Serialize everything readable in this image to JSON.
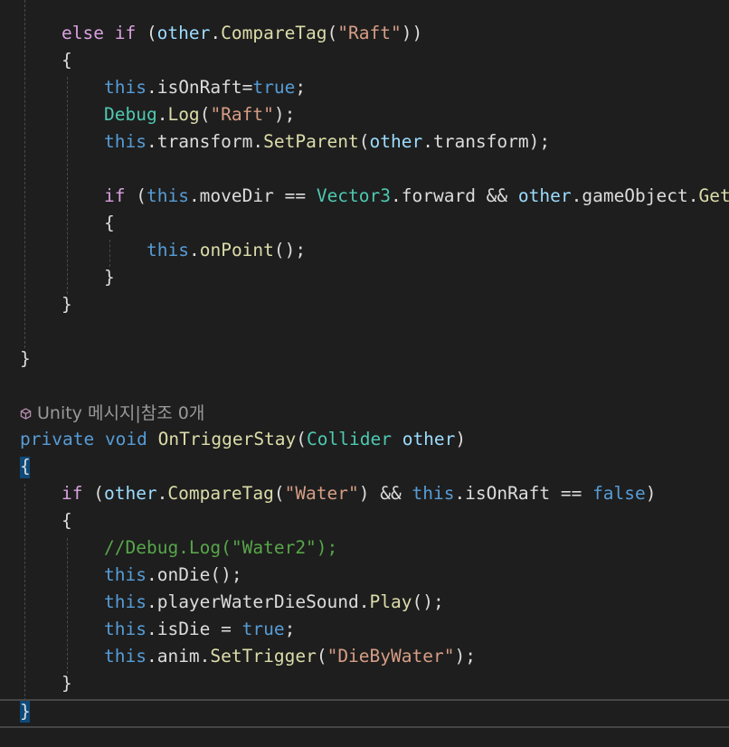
{
  "editor": {
    "codelens_unity": "Unity 메시지|참조 0개",
    "icon": "unity-cube-icon",
    "colors": {
      "background": "#1e1e1e",
      "keyword": "#569cd6",
      "control": "#d8a0df",
      "type": "#4ec9b0",
      "method": "#dcdcaa",
      "string": "#d69d85",
      "parameter": "#9cdcfe",
      "comment": "#57a64a",
      "plain": "#dcdcdc"
    },
    "code": {
      "l1": [
        "else if",
        " (",
        "other",
        ".",
        "CompareTag",
        "(",
        "\"Raft\"",
        "))"
      ],
      "l2": [
        "{"
      ],
      "l3": [
        "this",
        ".isOnRaft=",
        "true",
        ";"
      ],
      "l4": [
        "Debug",
        ".",
        "Log",
        "(",
        "\"Raft\"",
        ");"
      ],
      "l5": [
        "this",
        ".transform.",
        "SetParent",
        "(",
        "other",
        ".transform);"
      ],
      "l7": [
        "if",
        " (",
        "this",
        ".moveDir == ",
        "Vector3",
        ".forward && ",
        "other",
        ".gameObject.",
        "GetComponent"
      ],
      "l8": [
        "{"
      ],
      "l9": [
        "this",
        ".",
        "onPoint",
        "();"
      ],
      "l10": [
        "}"
      ],
      "l11": [
        "}"
      ],
      "l13": [
        "}"
      ],
      "l15": [
        "private",
        " ",
        "void",
        " ",
        "OnTriggerStay",
        "(",
        "Collider",
        " ",
        "other",
        ")"
      ],
      "l16": [
        "{"
      ],
      "l17": [
        "if",
        " (",
        "other",
        ".",
        "CompareTag",
        "(",
        "\"Water\"",
        ") && ",
        "this",
        ".isOnRaft == ",
        "false",
        ")"
      ],
      "l18": [
        "{"
      ],
      "l19": [
        "//Debug.Log(\"Water2\");"
      ],
      "l20": [
        "this",
        ".onDie();"
      ],
      "l21": [
        "this",
        ".playerWaterDieSound.",
        "Play",
        "();"
      ],
      "l22": [
        "this",
        ".isDie = ",
        "true",
        ";"
      ],
      "l23": [
        "this",
        ".anim.",
        "SetTrigger",
        "(",
        "\"DieByWater\"",
        ");"
      ],
      "l24": [
        "}"
      ],
      "l25": [
        "}"
      ]
    }
  }
}
